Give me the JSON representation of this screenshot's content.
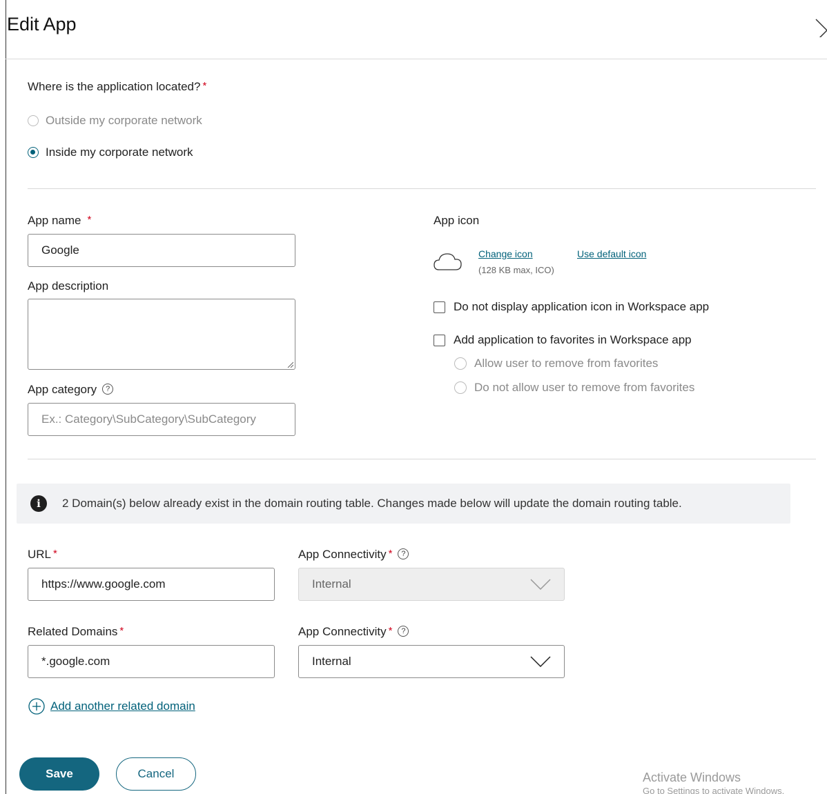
{
  "dialog": {
    "title": "Edit App",
    "close_icon": "close-icon"
  },
  "location": {
    "question": "Where is the application located?",
    "required_mark": "*",
    "options": [
      {
        "label": "Outside my corporate network",
        "selected": false,
        "disabled": true
      },
      {
        "label": "Inside my corporate network",
        "selected": true,
        "disabled": false
      }
    ]
  },
  "app_name": {
    "label": "App name",
    "required_mark": "*",
    "value": "Google"
  },
  "app_description": {
    "label": "App description",
    "value": ""
  },
  "app_category": {
    "label": "App category",
    "help_icon": "help-icon",
    "placeholder": "Ex.: Category\\SubCategory\\SubCategory"
  },
  "app_icon": {
    "label": "App icon",
    "icon": "cloud-icon",
    "change_link": "Change icon",
    "default_link": "Use default icon",
    "hint": "(128 KB max, ICO)"
  },
  "checkboxes": {
    "hide_icon": "Do not display application icon in Workspace app",
    "add_favorites": "Add application to favorites in Workspace app"
  },
  "favorites_options": [
    "Allow user to remove from favorites",
    "Do not allow user to remove from favorites"
  ],
  "banner": {
    "icon": "info-icon",
    "text": "2 Domain(s) below already exist in the domain routing table. Changes made below will update the domain routing table."
  },
  "url": {
    "label": "URL",
    "required_mark": "*",
    "value": "https://www.google.com"
  },
  "url_connectivity": {
    "label": "App Connectivity",
    "required_mark": "*",
    "value": "Internal",
    "disabled": true
  },
  "related_domains": {
    "label": "Related Domains",
    "required_mark": "*",
    "value": "*.google.com"
  },
  "domain_connectivity": {
    "label": "App Connectivity",
    "required_mark": "*",
    "value": "Internal"
  },
  "add_domain": {
    "icon": "plus-circle-icon",
    "label": "Add another related domain"
  },
  "actions": {
    "save": "Save",
    "cancel": "Cancel"
  },
  "watermark": {
    "line1": "Activate Windows",
    "line2": "Go to Settings to activate Windows."
  },
  "colors": {
    "accent": "#14667f",
    "required": "#d0021b",
    "banner_bg": "#f1f2f4"
  }
}
